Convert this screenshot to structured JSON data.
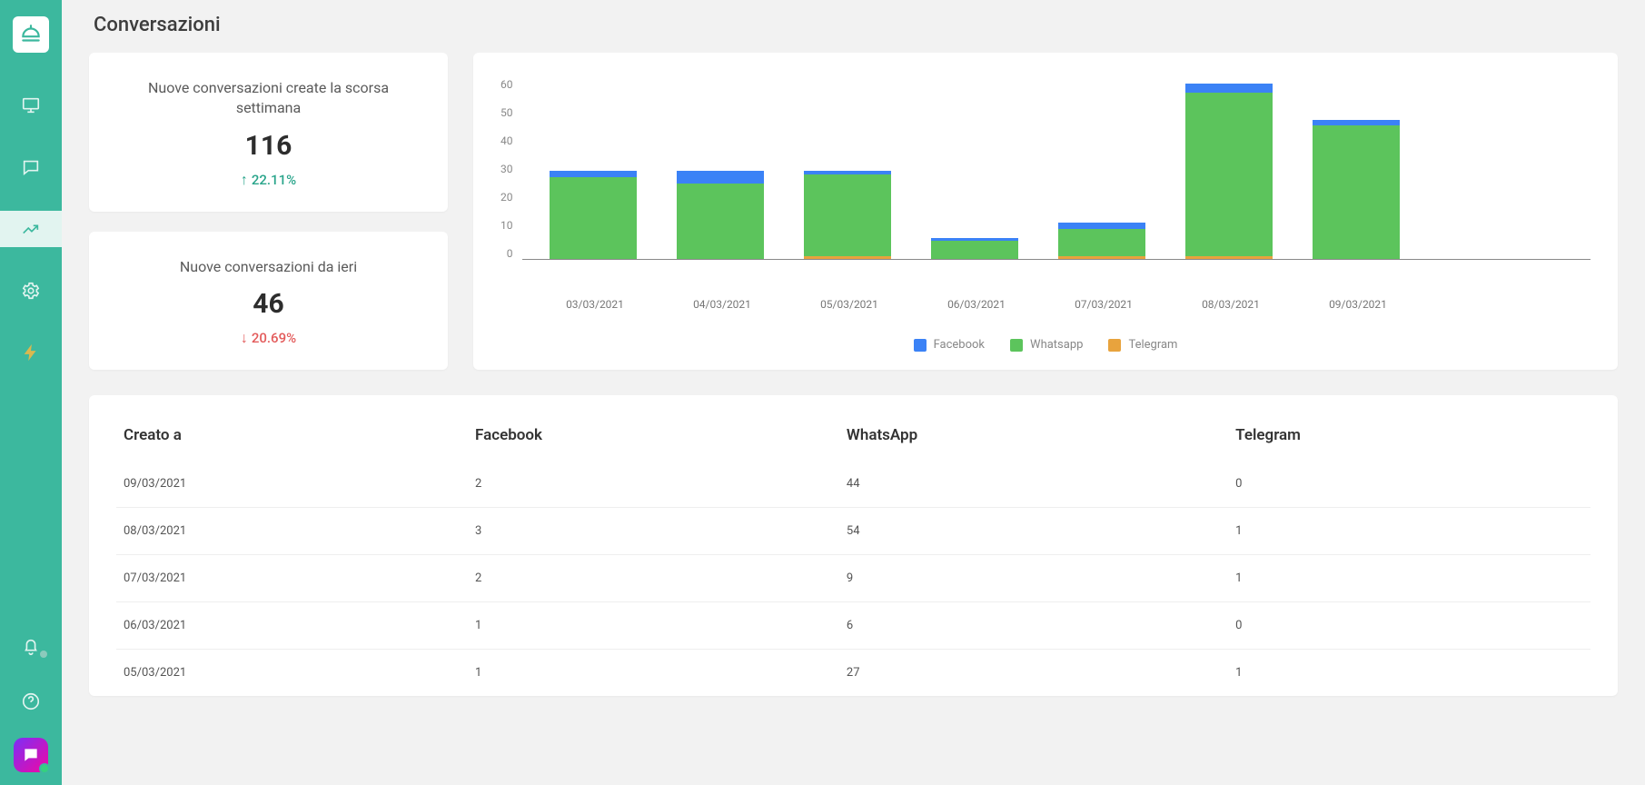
{
  "page": {
    "title": "Conversazioni"
  },
  "colors": {
    "facebook": "#3b82f6",
    "whatsapp": "#5cc45c",
    "telegram": "#e8a33d"
  },
  "metrics": {
    "last_week": {
      "title": "Nuove conversazioni create la scorsa settimana",
      "value": "116",
      "delta_dir": "up",
      "delta_text": "22.11%"
    },
    "yesterday": {
      "title": "Nuove conversazioni da ieri",
      "value": "46",
      "delta_dir": "down",
      "delta_text": "20.69%"
    }
  },
  "chart_data": {
    "type": "bar",
    "stacked": true,
    "ylim": [
      0,
      60
    ],
    "yticks": [
      0,
      10,
      20,
      30,
      40,
      50,
      60
    ],
    "categories": [
      "03/03/2021",
      "04/03/2021",
      "05/03/2021",
      "06/03/2021",
      "07/03/2021",
      "08/03/2021",
      "09/03/2021"
    ],
    "series": [
      {
        "name": "Facebook",
        "color": "#3b82f6",
        "values": [
          2,
          4,
          1,
          1,
          2,
          3,
          2
        ]
      },
      {
        "name": "Whatsapp",
        "color": "#5cc45c",
        "values": [
          27,
          25,
          27,
          6,
          9,
          54,
          44
        ]
      },
      {
        "name": "Telegram",
        "color": "#e8a33d",
        "values": [
          0,
          0,
          1,
          0,
          1,
          1,
          0
        ]
      }
    ],
    "legend": [
      "Facebook",
      "Whatsapp",
      "Telegram"
    ]
  },
  "table": {
    "columns": [
      "Creato a",
      "Facebook",
      "WhatsApp",
      "Telegram"
    ],
    "rows": [
      {
        "date": "09/03/2021",
        "facebook": "2",
        "whatsapp": "44",
        "telegram": "0"
      },
      {
        "date": "08/03/2021",
        "facebook": "3",
        "whatsapp": "54",
        "telegram": "1"
      },
      {
        "date": "07/03/2021",
        "facebook": "2",
        "whatsapp": "9",
        "telegram": "1"
      },
      {
        "date": "06/03/2021",
        "facebook": "1",
        "whatsapp": "6",
        "telegram": "0"
      },
      {
        "date": "05/03/2021",
        "facebook": "1",
        "whatsapp": "27",
        "telegram": "1"
      }
    ]
  }
}
